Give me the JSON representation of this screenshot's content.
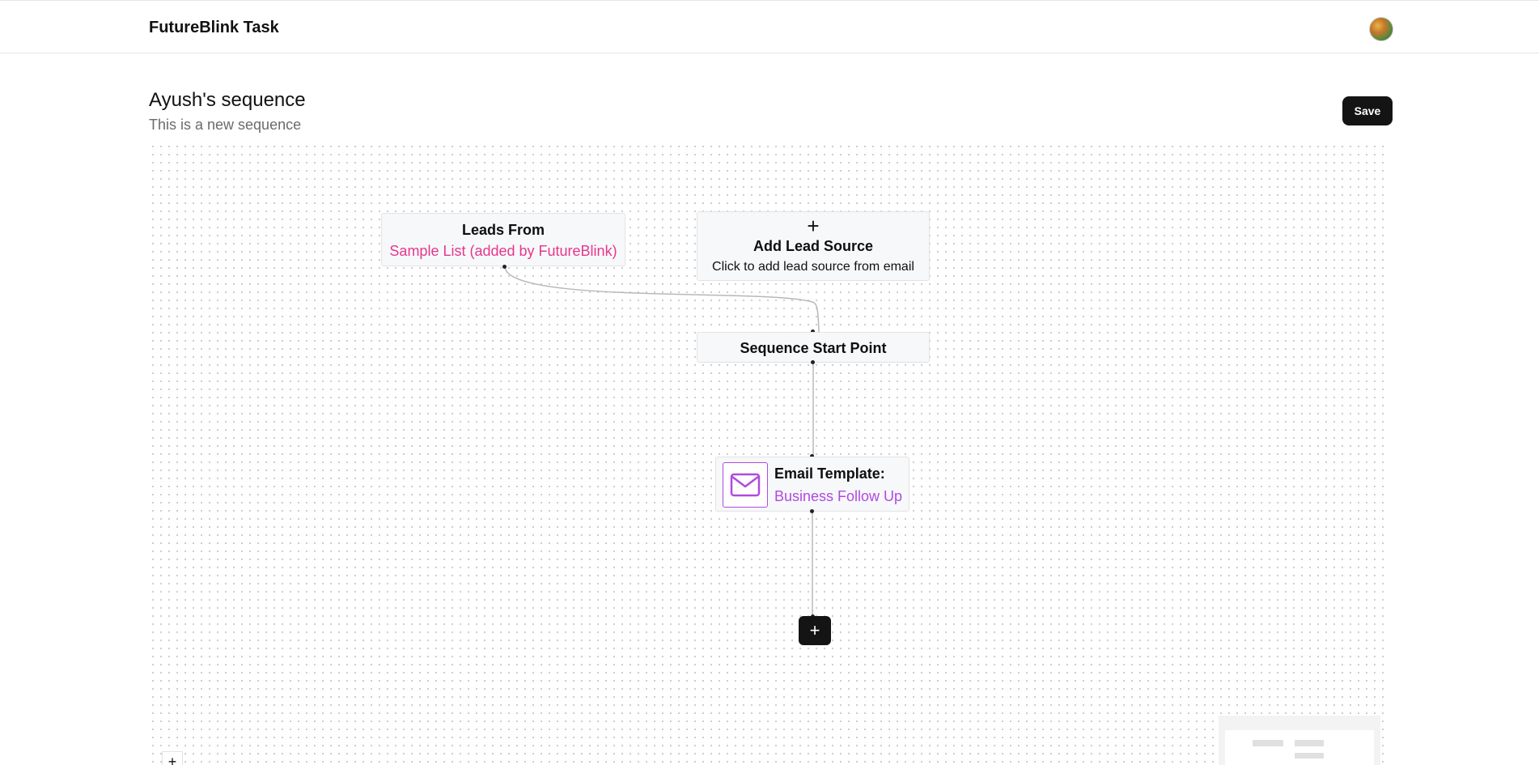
{
  "header": {
    "app_title": "FutureBlink Task",
    "avatar_icon": "user-avatar"
  },
  "sequence": {
    "title": "Ayush's sequence",
    "subtitle": "This is a new sequence",
    "save_label": "Save"
  },
  "nodes": {
    "leads_from": {
      "title": "Leads From",
      "value": "Sample List (added by FutureBlink)"
    },
    "add_lead_source": {
      "icon": "+",
      "title": "Add Lead Source",
      "description": "Click to add lead source from email"
    },
    "sequence_start": {
      "title": "Sequence Start Point"
    },
    "email_template": {
      "icon": "mail-icon",
      "title": "Email Template:",
      "value": "Business Follow Up"
    },
    "add_node": {
      "label": "+"
    }
  },
  "controls": {
    "zoom_in_label": "+"
  },
  "colors": {
    "leads_value": "#e6378d",
    "email_accent": "#b04ae0",
    "button_dark": "#141414"
  }
}
